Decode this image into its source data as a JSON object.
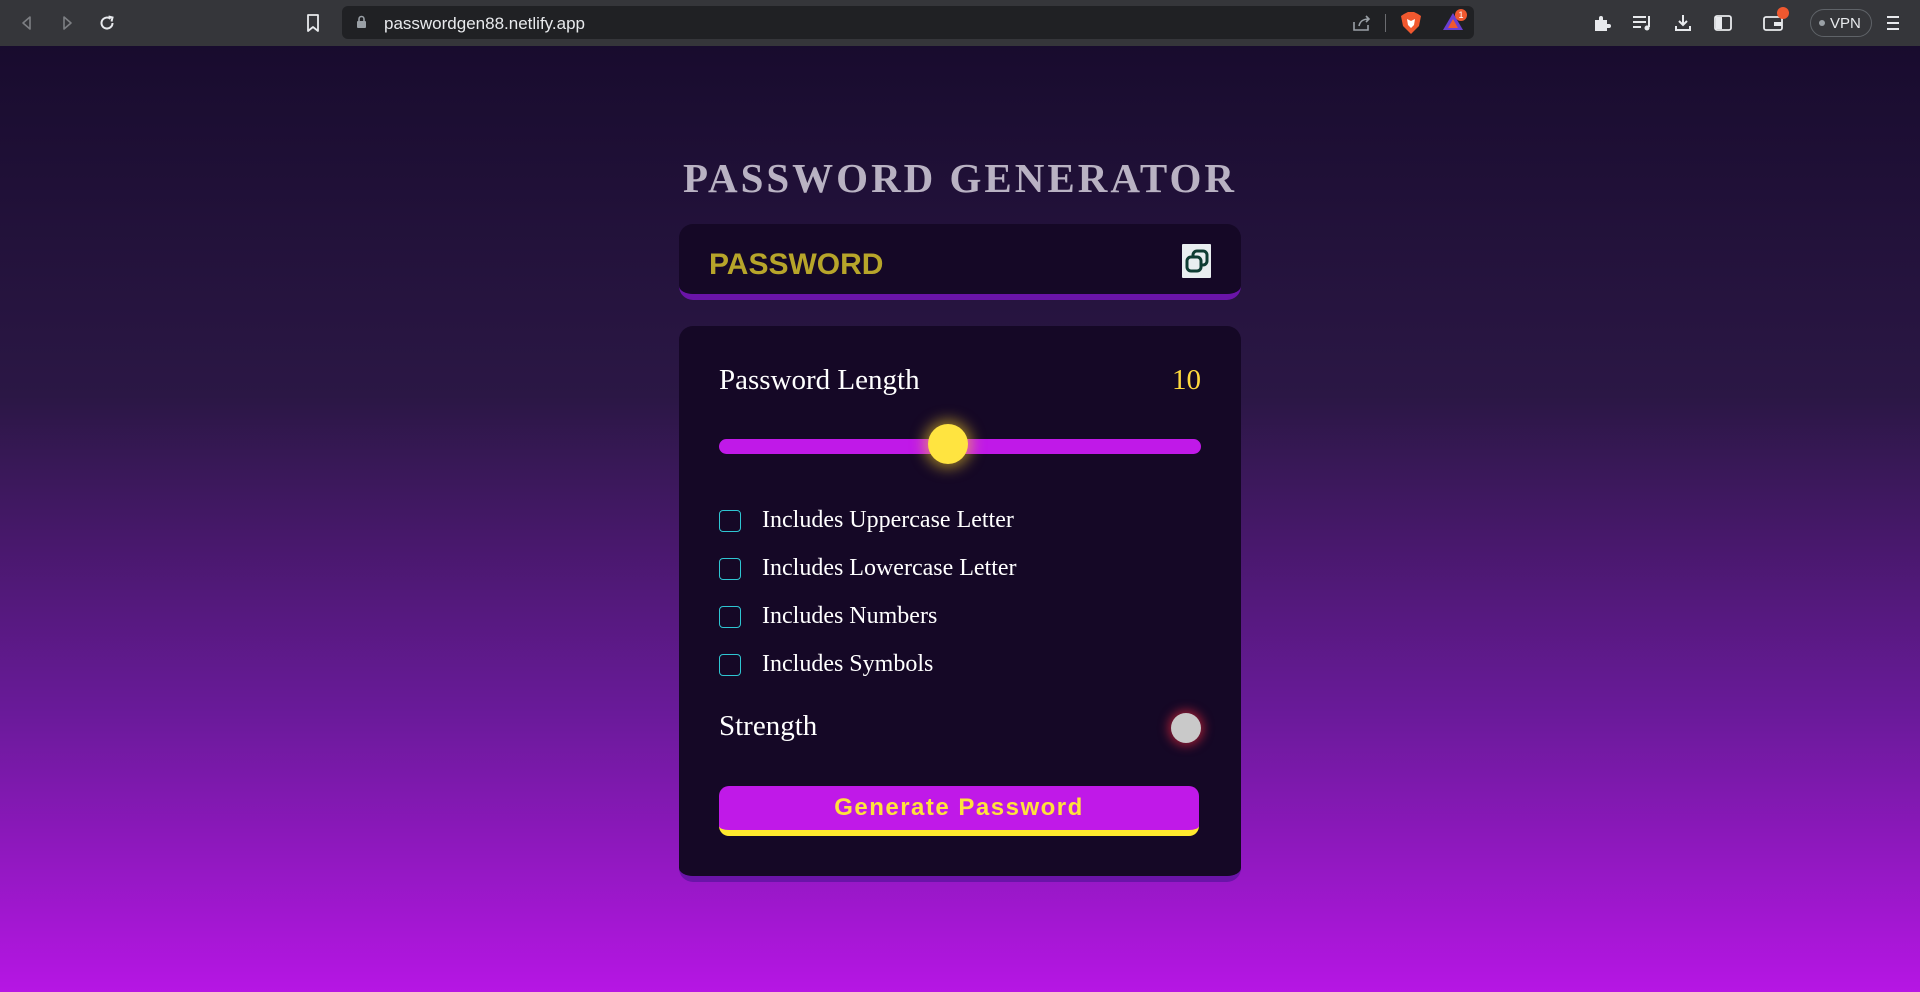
{
  "browser": {
    "url": "passwordgen88.netlify.app",
    "rewards_badge": "1",
    "vpn_label": "VPN"
  },
  "app": {
    "title": "PASSWORD GENERATOR",
    "password_display": "PASSWORD",
    "length_label": "Password Length",
    "length_value": "10",
    "slider_fraction": 0.475,
    "options": [
      {
        "label": "Includes Uppercase Letter",
        "checked": false
      },
      {
        "label": "Includes Lowercase Letter",
        "checked": false
      },
      {
        "label": "Includes Numbers",
        "checked": false
      },
      {
        "label": "Includes Symbols",
        "checked": false
      }
    ],
    "strength_label": "Strength",
    "strength_color": "#c9c9c9",
    "generate_label": "Generate Password"
  },
  "colors": {
    "accent": "#c019e8",
    "highlight": "#ffe440",
    "checkbox_border": "#2fc6d2"
  }
}
